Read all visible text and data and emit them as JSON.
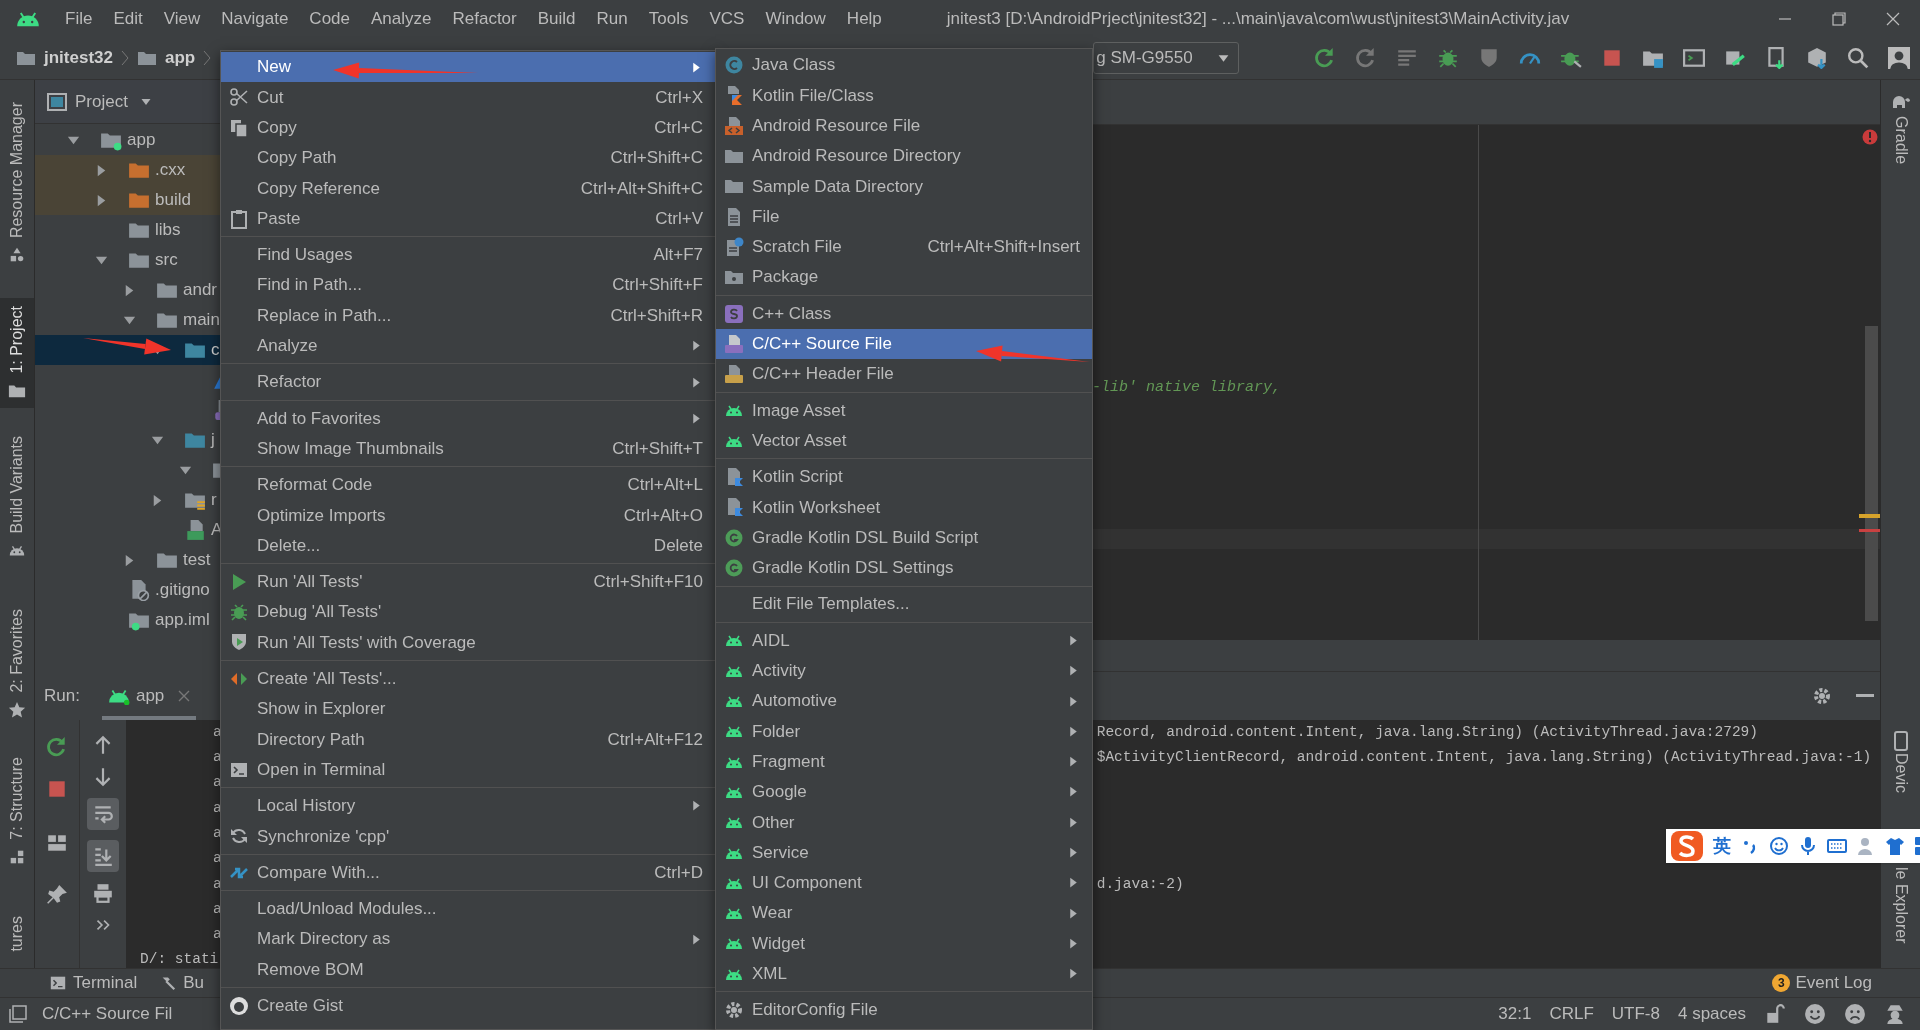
{
  "title_bar": {
    "menus": [
      "File",
      "Edit",
      "View",
      "Navigate",
      "Code",
      "Analyze",
      "Refactor",
      "Build",
      "Run",
      "Tools",
      "VCS",
      "Window",
      "Help"
    ],
    "title": "jnitest3 [D:\\AndroidPrject\\jnitest32] - ...\\main\\java\\com\\wust\\jnitest3\\MainActivity.jav"
  },
  "nav_bar": {
    "crumbs": [
      "jnitest32",
      "app"
    ],
    "device": "g SM-G9550"
  },
  "left_strip": [
    {
      "label": "Resource Manager",
      "selected": false
    },
    {
      "label": "1: Project",
      "selected": true
    },
    {
      "label": "Build Variants",
      "selected": false
    },
    {
      "label": "2: Favorites",
      "selected": false
    },
    {
      "label": "7: Structure",
      "selected": false
    },
    {
      "label": "tures",
      "selected": false
    }
  ],
  "project_panel": {
    "title": "Project",
    "tree": [
      {
        "label": "app",
        "kind": "module",
        "expanded": true,
        "selected": false,
        "children": [
          {
            "label": ".cxx",
            "kind": "folder",
            "expanded": false,
            "selected": false,
            "excluded": true
          },
          {
            "label": "build",
            "kind": "folder",
            "expanded": false,
            "selected": false,
            "excluded": true
          },
          {
            "label": "libs",
            "kind": "folder",
            "selected": false
          },
          {
            "label": "src",
            "kind": "folder",
            "expanded": true,
            "selected": false,
            "children": [
              {
                "label": "andr",
                "kind": "folder",
                "expanded": false,
                "selected": false
              },
              {
                "label": "main",
                "kind": "folder",
                "expanded": true,
                "selected": false,
                "children": [
                  {
                    "label": "c",
                    "kind": "source-folder",
                    "expanded": true,
                    "selected": true,
                    "children": [
                      {
                        "kind": "cmake-file",
                        "selected": false
                      },
                      {
                        "kind": "cpp-file",
                        "selected": false
                      }
                    ]
                  },
                  {
                    "label": "j",
                    "kind": "source-folder",
                    "expanded": true,
                    "selected": false,
                    "children": [
                      {
                        "kind": "package",
                        "expanded": true,
                        "selected": false
                      }
                    ]
                  },
                  {
                    "label": "r",
                    "kind": "res-folder",
                    "expanded": false,
                    "selected": false
                  },
                  {
                    "label": "A",
                    "kind": "manifest",
                    "selected": false
                  }
                ]
              },
              {
                "label": "test",
                "kind": "folder",
                "expanded": false,
                "selected": false
              }
            ]
          },
          {
            "label": ".gitigno",
            "kind": "ignore-file",
            "selected": false
          },
          {
            "label": "app.iml",
            "kind": "module-file",
            "selected": false
          }
        ]
      }
    ]
  },
  "editor": {
    "code_line": "-lib' native library,"
  },
  "run_panel": {
    "label": "Run:",
    "tab": "app",
    "lines": [
      {
        "start": "a",
        "indented": true,
        "tail": "Record, android.content.Intent, java.lang.String) (ActivityThread.java:2729)"
      },
      {
        "start": "a",
        "indented": true,
        "tail": "$ActivityClientRecord, android.content.Intent, java.lang.String) (ActivityThread.java:-1)"
      },
      {
        "start": "a",
        "indented": true
      },
      {
        "start": "a",
        "indented": true
      },
      {
        "start": "a",
        "indented": true
      },
      {
        "start": "a",
        "indented": true
      },
      {
        "start": "a",
        "indented": true,
        "tail": "d.java:-2)"
      },
      {
        "start": "a",
        "indented": true
      },
      {
        "start": "a",
        "indented": true
      },
      {
        "start": "D/: stati",
        "indented": false
      }
    ]
  },
  "bottom_tabs": [
    {
      "label": "Terminal"
    },
    {
      "label": "Bu"
    }
  ],
  "event_log": {
    "badge": "3",
    "label": "Event Log"
  },
  "right_strip": {
    "top": "Gradle",
    "device_start": "Devic",
    "device_end": "le Explorer"
  },
  "ime_toolbar": {
    "mode": "英"
  },
  "status_bar": {
    "left": "C/C++ Source Fil",
    "items": [
      "32:1",
      "CRLF",
      "UTF-8",
      "4 spaces"
    ]
  },
  "context_menu": [
    {
      "kind": "item",
      "label": "New",
      "submenu": true,
      "selected": true
    },
    {
      "kind": "item",
      "label": "Cut",
      "shortcut": "Ctrl+X",
      "selected": false
    },
    {
      "kind": "item",
      "label": "Copy",
      "shortcut": "Ctrl+C",
      "selected": false
    },
    {
      "kind": "item",
      "label": "Copy Path",
      "shortcut": "Ctrl+Shift+C",
      "selected": false
    },
    {
      "kind": "item",
      "label": "Copy Reference",
      "shortcut": "Ctrl+Alt+Shift+C",
      "selected": false
    },
    {
      "kind": "item",
      "label": "Paste",
      "shortcut": "Ctrl+V",
      "selected": false
    },
    {
      "kind": "separator"
    },
    {
      "kind": "item",
      "label": "Find Usages",
      "shortcut": "Alt+F7",
      "selected": false
    },
    {
      "kind": "item",
      "label": "Find in Path...",
      "shortcut": "Ctrl+Shift+F",
      "selected": false
    },
    {
      "kind": "item",
      "label": "Replace in Path...",
      "shortcut": "Ctrl+Shift+R",
      "selected": false
    },
    {
      "kind": "item",
      "label": "Analyze",
      "submenu": true,
      "selected": false
    },
    {
      "kind": "separator"
    },
    {
      "kind": "item",
      "label": "Refactor",
      "submenu": true,
      "selected": false
    },
    {
      "kind": "separator"
    },
    {
      "kind": "item",
      "label": "Add to Favorites",
      "submenu": true,
      "selected": false
    },
    {
      "kind": "item",
      "label": "Show Image Thumbnails",
      "shortcut": "Ctrl+Shift+T",
      "selected": false
    },
    {
      "kind": "separator"
    },
    {
      "kind": "item",
      "label": "Reformat Code",
      "shortcut": "Ctrl+Alt+L",
      "selected": false
    },
    {
      "kind": "item",
      "label": "Optimize Imports",
      "shortcut": "Ctrl+Alt+O",
      "selected": false
    },
    {
      "kind": "item",
      "label": "Delete...",
      "shortcut": "Delete",
      "selected": false
    },
    {
      "kind": "separator"
    },
    {
      "kind": "item",
      "label": "Run 'All Tests'",
      "shortcut": "Ctrl+Shift+F10",
      "selected": false
    },
    {
      "kind": "item",
      "label": "Debug 'All Tests'",
      "selected": false
    },
    {
      "kind": "item",
      "label": "Run 'All Tests' with Coverage",
      "selected": false
    },
    {
      "kind": "separator"
    },
    {
      "kind": "item",
      "label": "Create 'All Tests'...",
      "selected": false
    },
    {
      "kind": "item",
      "label": "Show in Explorer",
      "selected": false
    },
    {
      "kind": "item",
      "label": "Directory Path",
      "shortcut": "Ctrl+Alt+F12",
      "selected": false
    },
    {
      "kind": "item",
      "label": "Open in Terminal",
      "selected": false
    },
    {
      "kind": "separator"
    },
    {
      "kind": "item",
      "label": "Local History",
      "submenu": true,
      "selected": false
    },
    {
      "kind": "item",
      "label": "Synchronize 'cpp'",
      "selected": false
    },
    {
      "kind": "separator"
    },
    {
      "kind": "item",
      "label": "Compare With...",
      "shortcut": "Ctrl+D",
      "selected": false
    },
    {
      "kind": "separator"
    },
    {
      "kind": "item",
      "label": "Load/Unload Modules...",
      "selected": false
    },
    {
      "kind": "item",
      "label": "Mark Directory as",
      "submenu": true,
      "selected": false
    },
    {
      "kind": "item",
      "label": "Remove BOM",
      "selected": false
    },
    {
      "kind": "separator"
    },
    {
      "kind": "item",
      "label": "Create Gist",
      "selected": false
    }
  ],
  "new_submenu": [
    {
      "kind": "item",
      "label": "Java Class",
      "selected": false
    },
    {
      "kind": "item",
      "label": "Kotlin File/Class",
      "selected": false
    },
    {
      "kind": "item",
      "label": "Android Resource File",
      "selected": false
    },
    {
      "kind": "item",
      "label": "Android Resource Directory",
      "selected": false
    },
    {
      "kind": "item",
      "label": "Sample Data Directory",
      "selected": false
    },
    {
      "kind": "item",
      "label": "File",
      "selected": false
    },
    {
      "kind": "item",
      "label": "Scratch File",
      "shortcut": "Ctrl+Alt+Shift+Insert",
      "selected": false
    },
    {
      "kind": "item",
      "label": "Package",
      "selected": false
    },
    {
      "kind": "separator"
    },
    {
      "kind": "item",
      "label": "C++ Class",
      "selected": false
    },
    {
      "kind": "item",
      "label": "C/C++ Source File",
      "selected": true
    },
    {
      "kind": "item",
      "label": "C/C++ Header File",
      "selected": false
    },
    {
      "kind": "separator"
    },
    {
      "kind": "item",
      "label": "Image Asset",
      "selected": false
    },
    {
      "kind": "item",
      "label": "Vector Asset",
      "selected": false
    },
    {
      "kind": "separator"
    },
    {
      "kind": "item",
      "label": "Kotlin Script",
      "selected": false
    },
    {
      "kind": "item",
      "label": "Kotlin Worksheet",
      "selected": false
    },
    {
      "kind": "item",
      "label": "Gradle Kotlin DSL Build Script",
      "selected": false
    },
    {
      "kind": "item",
      "label": "Gradle Kotlin DSL Settings",
      "selected": false
    },
    {
      "kind": "separator"
    },
    {
      "kind": "item",
      "label": "Edit File Templates...",
      "selected": false
    },
    {
      "kind": "separator"
    },
    {
      "kind": "item",
      "label": "AIDL",
      "submenu": true,
      "selected": false
    },
    {
      "kind": "item",
      "label": "Activity",
      "submenu": true,
      "selected": false
    },
    {
      "kind": "item",
      "label": "Automotive",
      "submenu": true,
      "selected": false
    },
    {
      "kind": "item",
      "label": "Folder",
      "submenu": true,
      "selected": false
    },
    {
      "kind": "item",
      "label": "Fragment",
      "submenu": true,
      "selected": false
    },
    {
      "kind": "item",
      "label": "Google",
      "submenu": true,
      "selected": false
    },
    {
      "kind": "item",
      "label": "Other",
      "submenu": true,
      "selected": false
    },
    {
      "kind": "item",
      "label": "Service",
      "submenu": true,
      "selected": false
    },
    {
      "kind": "item",
      "label": "UI Component",
      "submenu": true,
      "selected": false
    },
    {
      "kind": "item",
      "label": "Wear",
      "submenu": true,
      "selected": false
    },
    {
      "kind": "item",
      "label": "Widget",
      "submenu": true,
      "selected": false
    },
    {
      "kind": "item",
      "label": "XML",
      "submenu": true,
      "selected": false
    },
    {
      "kind": "separator"
    },
    {
      "kind": "item",
      "label": "EditorConfig File",
      "selected": false
    }
  ]
}
